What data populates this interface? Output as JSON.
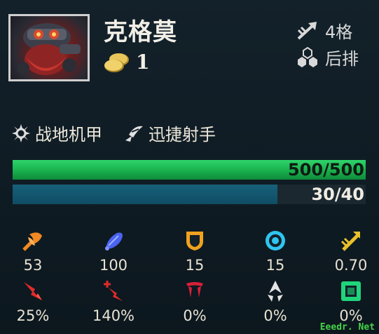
{
  "champion": {
    "name": "克格莫",
    "cost": "1",
    "range_label": "4格",
    "position_label": "后排"
  },
  "traits": [
    {
      "name": "战地机甲",
      "icon": "battle-mech-icon"
    },
    {
      "name": "迅捷射手",
      "icon": "rapidfire-icon"
    }
  ],
  "health": {
    "text": "500/500",
    "current": 500,
    "max": 500,
    "color": "#1fbf58"
  },
  "mana": {
    "text": "30/40",
    "current": 30,
    "max": 40,
    "color": "#13566f"
  },
  "stats": [
    {
      "icon": "attack-damage-icon",
      "value": "53",
      "color": "#f08a22"
    },
    {
      "icon": "ability-power-icon",
      "value": "100",
      "color": "#4a63f2"
    },
    {
      "icon": "armor-icon",
      "value": "15",
      "color": "#f0a21e"
    },
    {
      "icon": "magic-resist-icon",
      "value": "15",
      "color": "#2ec6f0"
    },
    {
      "icon": "attack-speed-icon",
      "value": "0.70",
      "color": "#e9c12a"
    },
    {
      "icon": "crit-chance-icon",
      "value": "25%",
      "color": "#e22a2a"
    },
    {
      "icon": "crit-damage-icon",
      "value": "140%",
      "color": "#e22a2a"
    },
    {
      "icon": "omnivamp-icon",
      "value": "0%",
      "color": "#d8203a"
    },
    {
      "icon": "dodge-icon",
      "value": "0%",
      "color": "#e4e4e4"
    },
    {
      "icon": "durability-icon",
      "value": "0%",
      "color": "#1fd47a"
    }
  ],
  "watermark": "Eeedr. Net"
}
